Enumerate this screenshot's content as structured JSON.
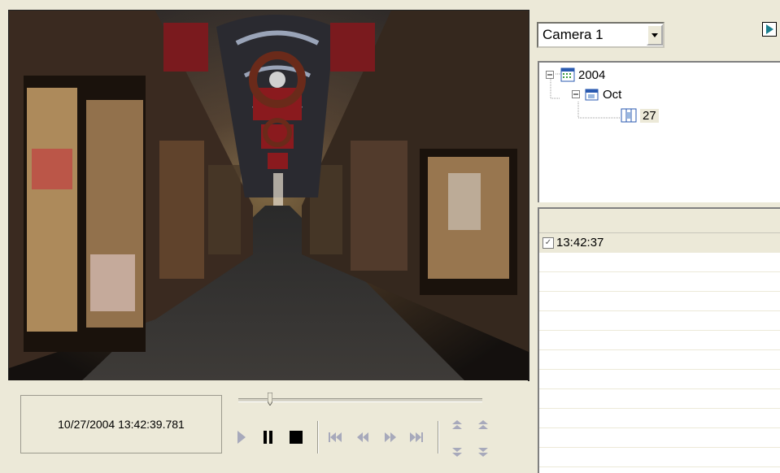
{
  "player": {
    "timestamp": "10/27/2004 13:42:39.781",
    "seek_position": 0.13,
    "buttons": {
      "play": "play-icon",
      "pause": "pause-icon",
      "stop": "stop-icon",
      "skip_start": "skip-start-icon",
      "rewind": "rewind-icon",
      "fast_forward": "fast-forward-icon",
      "skip_end": "skip-end-icon",
      "speed_up": "speed-up-icon",
      "speed_up_alt": "speed-up-alt-icon",
      "speed_down": "speed-down-icon",
      "speed_down_alt": "speed-down-alt-icon"
    }
  },
  "camera": {
    "selected": "Camera 1"
  },
  "tree": {
    "year": "2004",
    "month": "Oct",
    "day": "27"
  },
  "recordings": {
    "items": [
      {
        "time": "13:42:37",
        "checked": true
      }
    ]
  },
  "colors": {
    "background": "#ece9d8",
    "border": "#9c9a8e",
    "disabled_icon": "#a7a9bb",
    "export_icon": "#1a7f8f"
  }
}
